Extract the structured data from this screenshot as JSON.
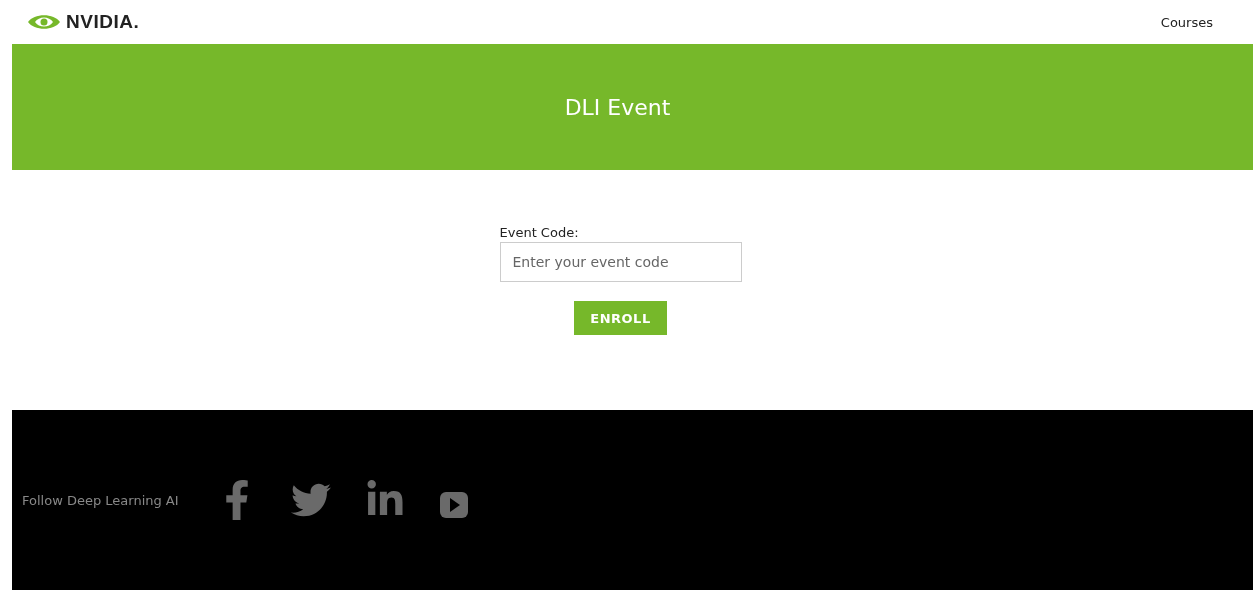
{
  "header": {
    "logo_text": "NVIDIA.",
    "nav_link": "Courses"
  },
  "banner": {
    "title": "DLI Event"
  },
  "form": {
    "label": "Event Code:",
    "placeholder": "Enter your event code",
    "button": "ENROLL"
  },
  "footer": {
    "follow_text": "Follow Deep Learning AI",
    "social": [
      {
        "kind": "facebook"
      },
      {
        "kind": "twitter"
      },
      {
        "kind": "linkedin"
      },
      {
        "kind": "video"
      }
    ]
  }
}
